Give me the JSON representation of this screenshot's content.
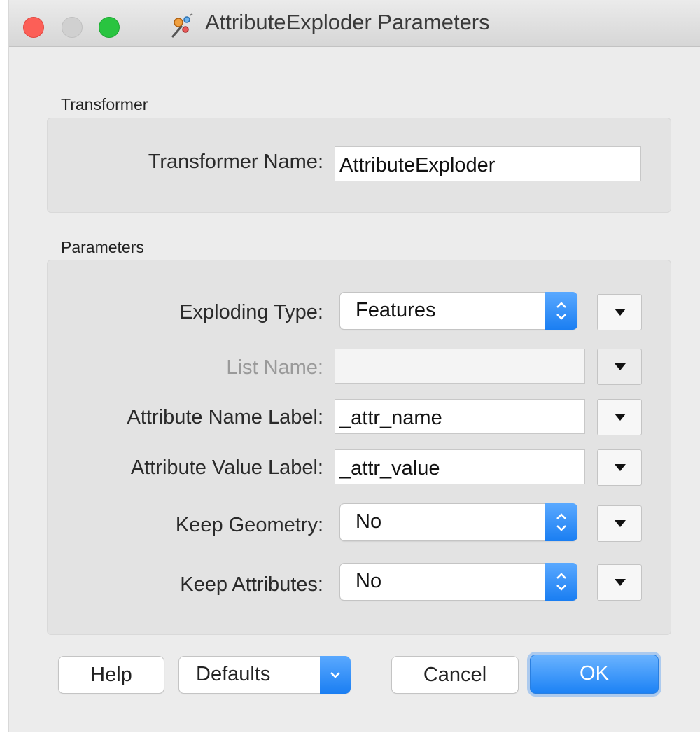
{
  "window": {
    "title": "AttributeExploder Parameters",
    "title_icon": "transformer-icon"
  },
  "transformer_section": {
    "label": "Transformer",
    "name_label": "Transformer Name:",
    "name_value": "AttributeExploder"
  },
  "parameters_section": {
    "label": "Parameters",
    "exploding_type": {
      "label": "Exploding Type:",
      "value": "Features"
    },
    "list_name": {
      "label": "List Name:",
      "value": "",
      "enabled": false
    },
    "attribute_name_label": {
      "label": "Attribute Name Label:",
      "value": "_attr_name"
    },
    "attribute_value_label": {
      "label": "Attribute Value Label:",
      "value": "_attr_value"
    },
    "keep_geometry": {
      "label": "Keep Geometry:",
      "value": "No"
    },
    "keep_attributes": {
      "label": "Keep Attributes:",
      "value": "No"
    }
  },
  "buttons": {
    "help": "Help",
    "defaults": "Defaults",
    "cancel": "Cancel",
    "ok": "OK"
  },
  "colors": {
    "accent": "#1c82f5",
    "close": "#fc5f57",
    "maximize": "#29c440"
  }
}
